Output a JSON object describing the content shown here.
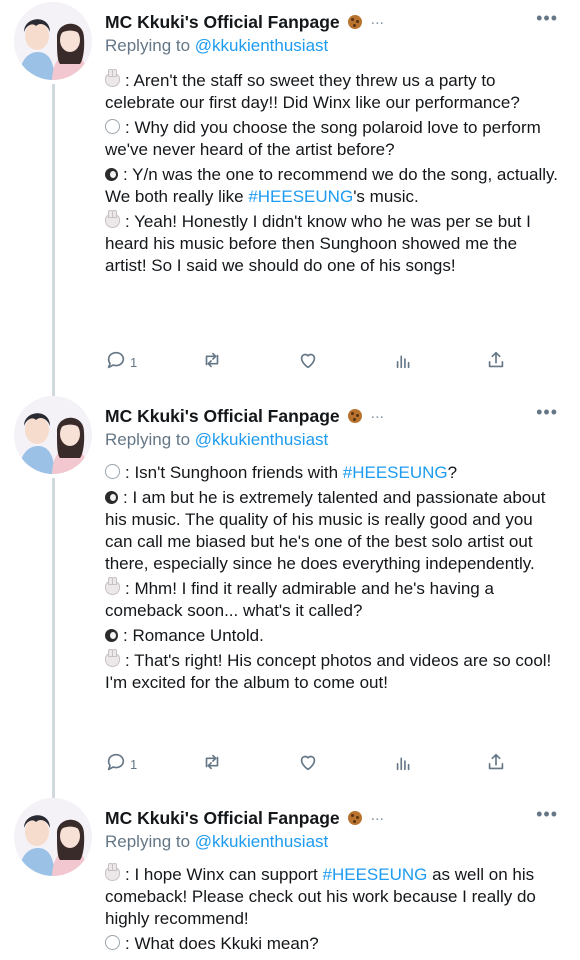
{
  "tweets": [
    {
      "author": "MC Kkuki's Official Fanpage",
      "replying_prefix": "Replying to ",
      "replying_handle": "@kkukienthusiast",
      "reply_count": "1",
      "lines": [
        {
          "icon": "bunny",
          "before": ": Aren't the staff so sweet they threw us a party to celebrate our first day!! Did Winx like our performance?",
          "tag": "",
          "after": ""
        },
        {
          "icon": "speech-bubble",
          "before": ": Why did you choose the song polaroid love to perform we've never heard of the artist before?",
          "tag": "",
          "after": ""
        },
        {
          "icon": "penguin",
          "before": ": Y/n was the one to recommend we do the song, actually. We both really like ",
          "tag": "#HEESEUNG",
          "after": "'s music."
        },
        {
          "icon": "bunny",
          "before": ": Yeah! Honestly I didn't know who he was per se but I heard his music before then Sunghoon showed me the artist! So I said we should do one of his songs!",
          "tag": "",
          "after": ""
        }
      ]
    },
    {
      "author": "MC Kkuki's Official Fanpage",
      "replying_prefix": "Replying to ",
      "replying_handle": "@kkukienthusiast",
      "reply_count": "1",
      "lines": [
        {
          "icon": "speech-bubble",
          "before": ": Isn't Sunghoon friends with ",
          "tag": "#HEESEUNG",
          "after": "?"
        },
        {
          "icon": "penguin",
          "before": ": I am but he is extremely talented and passionate about his music. The quality of his music is really good and you can call me biased but he's one of the best solo artist out there, especially since he does everything independently.",
          "tag": "",
          "after": ""
        },
        {
          "icon": "bunny",
          "before": ": Mhm! I find it really admirable and he's having a comeback soon... what's it called?",
          "tag": "",
          "after": ""
        },
        {
          "icon": "penguin",
          "before": ": Romance Untold.",
          "tag": "",
          "after": ""
        },
        {
          "icon": "bunny",
          "before": ": That's right! His concept photos and videos are so cool! I'm excited for the album to come out!",
          "tag": "",
          "after": ""
        }
      ]
    },
    {
      "author": "MC Kkuki's Official Fanpage",
      "replying_prefix": "Replying to ",
      "replying_handle": "@kkukienthusiast",
      "reply_count": "",
      "lines": [
        {
          "icon": "bunny",
          "before": ": I hope Winx can support ",
          "tag": "#HEESEUNG",
          "after": " as well on his comeback! Please check out his work because I really do highly recommend!"
        },
        {
          "icon": "speech-bubble",
          "before": ": What does Kkuki mean?",
          "tag": "",
          "after": ""
        }
      ]
    }
  ],
  "ui": {
    "name_ellipsis": "...",
    "more_menu": "•••"
  },
  "colors": {
    "link": "#1d9bf0",
    "secondary_text": "#657786",
    "thread_line": "#cfd9de"
  }
}
